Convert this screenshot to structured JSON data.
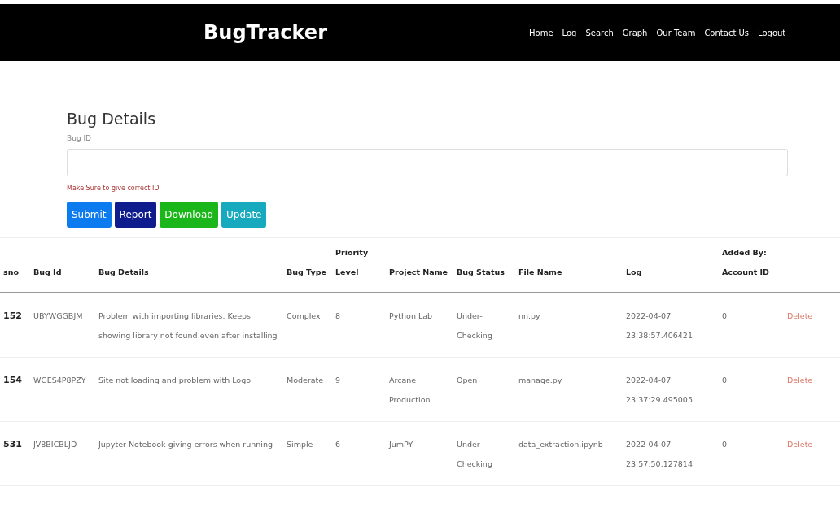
{
  "navbar": {
    "brand": "BugTracker",
    "links": [
      "Home",
      "Log",
      "Search",
      "Graph",
      "Our Team",
      "Contact Us",
      "Logout"
    ]
  },
  "form": {
    "title": "Bug Details",
    "field_label": "Bug ID",
    "hint": "Make Sure to give correct ID",
    "buttons": [
      {
        "label": "Submit",
        "kind": "primary"
      },
      {
        "label": "Report",
        "kind": "dark"
      },
      {
        "label": "Download",
        "kind": "success"
      },
      {
        "label": "Update",
        "kind": "info"
      }
    ]
  },
  "table": {
    "columns": [
      [
        "sno"
      ],
      [
        "Bug Id"
      ],
      [
        "Bug Details"
      ],
      [
        "Bug Type"
      ],
      [
        "Priority",
        "Level"
      ],
      [
        "Project Name"
      ],
      [
        "Bug Status"
      ],
      [
        "File Name"
      ],
      [
        "Log"
      ],
      [
        "Added By:",
        "Account ID"
      ],
      []
    ],
    "rows": [
      {
        "sno": "152",
        "bug_id": "UBYWGGBJM",
        "details": "Problem with importing libraries. Keeps showing library not found even after installing",
        "type": "Complex",
        "priority": "8",
        "project": "Python Lab",
        "status": "Under-Checking",
        "file": "nn.py",
        "log": "2022-04-07 23:38:57.406421",
        "added_by": "0",
        "action": "Delete"
      },
      {
        "sno": "154",
        "bug_id": "WGES4P8PZY",
        "details": "Site not loading and problem with Logo",
        "type": "Moderate",
        "priority": "9",
        "project": "Arcane Production",
        "status": "Open",
        "file": "manage.py",
        "log": "2022-04-07 23:37:29.495005",
        "added_by": "0",
        "action": "Delete"
      },
      {
        "sno": "531",
        "bug_id": "JV8BICBLJD",
        "details": "Jupyter Notebook giving errors when running",
        "type": "Simple",
        "priority": "6",
        "project": "JumPY",
        "status": "Under-Checking",
        "file": "data_extraction.ipynb",
        "log": "2022-04-07 23:57:50.127814",
        "added_by": "0",
        "action": "Delete"
      }
    ]
  }
}
